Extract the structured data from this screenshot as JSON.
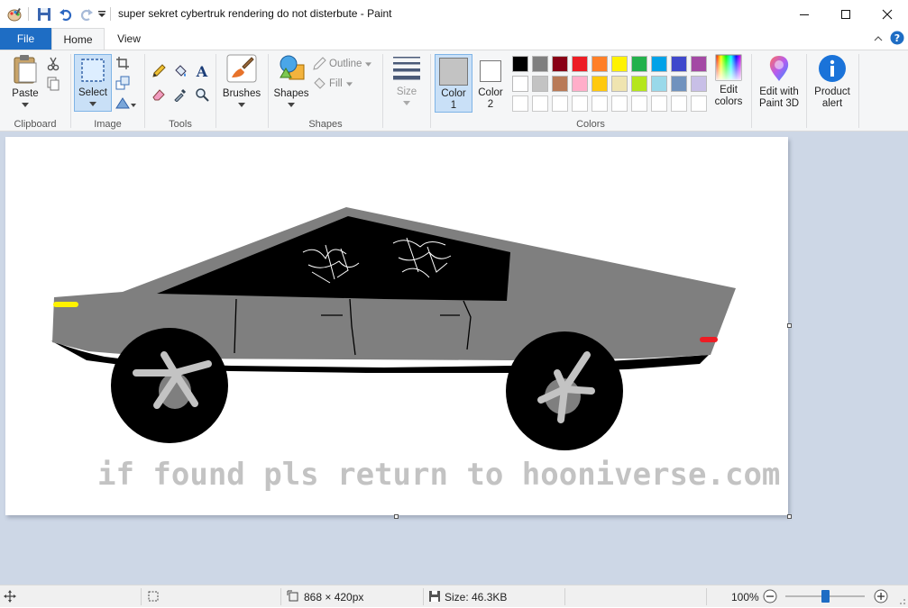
{
  "window": {
    "title": "super sekret cybertruk rendering do not disterbute - Paint",
    "controls": {
      "minimize": "minimize",
      "maximize": "maximize",
      "close": "close"
    }
  },
  "quick_access": [
    "paint-app-icon",
    "save-icon",
    "undo-icon",
    "redo-icon",
    "customize-chevron-icon"
  ],
  "tabs": [
    {
      "label": "File",
      "active": false
    },
    {
      "label": "Home",
      "active": true
    },
    {
      "label": "View",
      "active": false
    }
  ],
  "ribbon": {
    "clipboard": {
      "group_label": "Clipboard",
      "paste_label": "Paste"
    },
    "image": {
      "group_label": "Image",
      "select_label": "Select"
    },
    "tools": {
      "group_label": "Tools"
    },
    "brushes": {
      "label": "Brushes"
    },
    "shapes": {
      "group_label": "Shapes",
      "shapes_label": "Shapes",
      "outline_label": "Outline",
      "fill_label": "Fill"
    },
    "size": {
      "label": "Size"
    },
    "colors": {
      "group_label": "Colors",
      "color1_label": "Color",
      "color1_num": "1",
      "color2_label": "Color",
      "color2_num": "2",
      "color1_value": "#c3c3c3",
      "color2_value": "#ffffff",
      "palette_row1": [
        "#000000",
        "#7f7f7f",
        "#880015",
        "#ed1c24",
        "#ff7f27",
        "#fff200",
        "#22b14c",
        "#00a2e8",
        "#3f48cc",
        "#a349a4"
      ],
      "palette_row2": [
        "#ffffff",
        "#c3c3c3",
        "#b97a57",
        "#ffaec9",
        "#ffc90e",
        "#efe4b0",
        "#b5e61d",
        "#99d9ea",
        "#7092be",
        "#c8bfe7"
      ],
      "edit_colors_line1": "Edit",
      "edit_colors_line2": "colors"
    },
    "paint3d": {
      "line1": "Edit with",
      "line2": "Paint 3D"
    },
    "product_alert": {
      "line1": "Product",
      "line2": "alert"
    }
  },
  "canvas": {
    "caption": "if found pls return to hooniverse.com",
    "body_color": "#7f7f7f",
    "window_color": "#000000",
    "headlight_color": "#fff200",
    "taillight_color": "#ed1c24",
    "wheel_spoke_color": "#c3c3c3"
  },
  "status": {
    "dimensions": "868 × 420px",
    "size": "Size: 46.3KB",
    "zoom": "100%",
    "zoom_fraction": 0.5
  }
}
